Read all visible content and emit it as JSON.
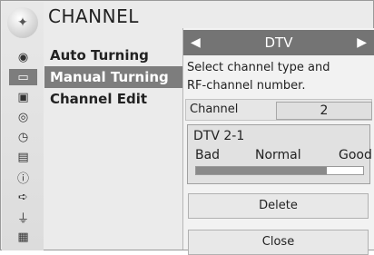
{
  "header": {
    "title": "CHANNEL"
  },
  "menu": {
    "items": [
      {
        "label": "Auto Turning",
        "selected": false
      },
      {
        "label": "Manual Turning",
        "selected": true
      },
      {
        "label": "Channel Edit",
        "selected": false
      }
    ]
  },
  "sidebar_icons": [
    "signal-dish-icon",
    "tv-screen-icon",
    "display-icon",
    "option-icon",
    "clock-icon",
    "lock-icon",
    "info-icon",
    "input-plug-icon",
    "usb-icon",
    "movie-clapper-icon"
  ],
  "panel": {
    "type_value": "DTV",
    "description_line1": "Select channel type and",
    "description_line2": "RF-channel number.",
    "channel_label": "Channel",
    "channel_value": "2",
    "signal": {
      "channel_name": "DTV 2-1",
      "bad_label": "Bad",
      "normal_label": "Normal",
      "good_label": "Good",
      "strength": 0.78
    },
    "delete_label": "Delete",
    "close_label": "Close"
  },
  "colors": {
    "highlight": "#7d7d7d",
    "background": "#ebebeb"
  }
}
